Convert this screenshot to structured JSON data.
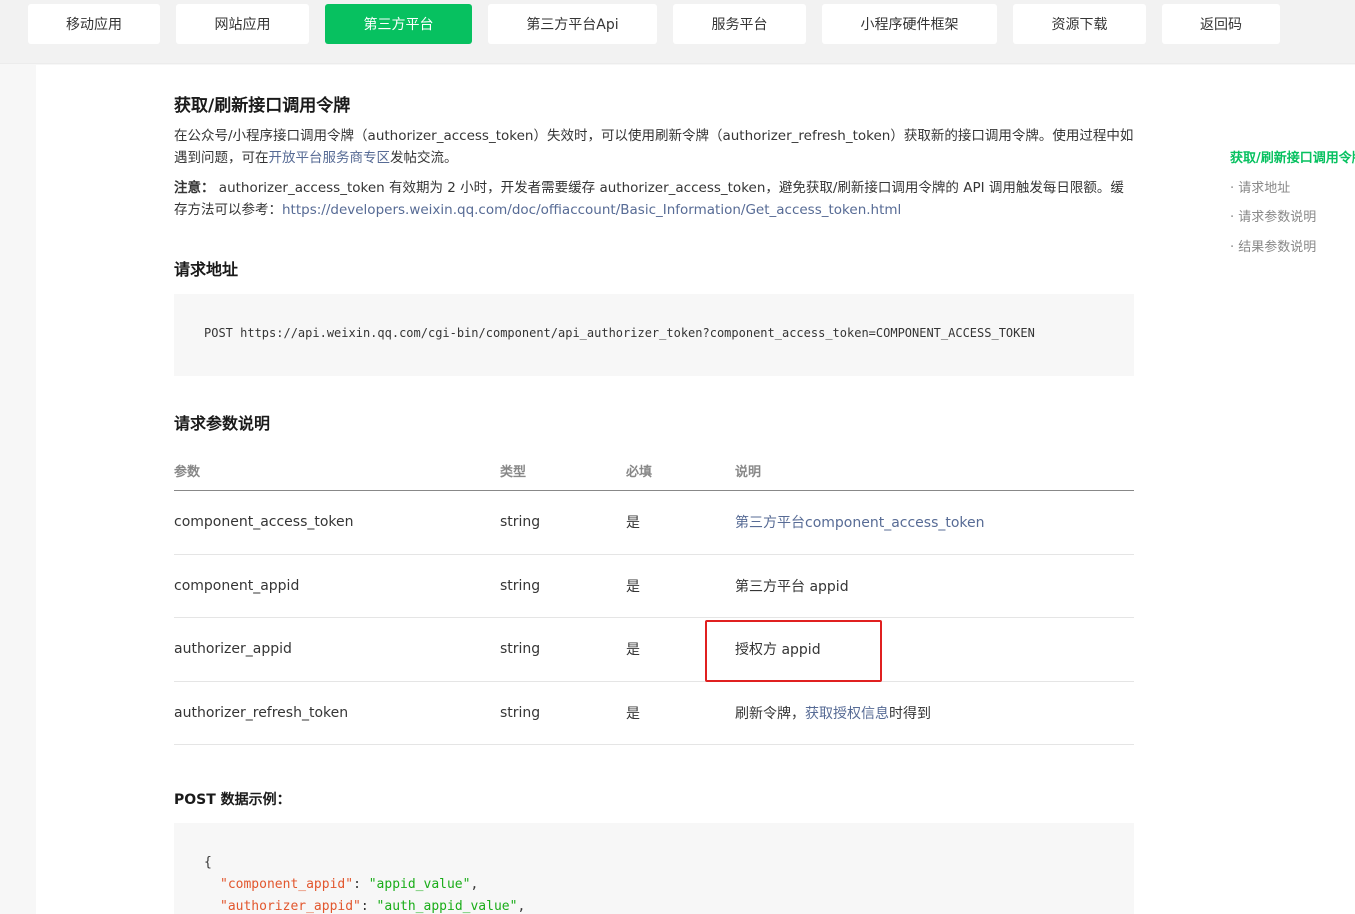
{
  "nav": {
    "tabs": [
      {
        "label": "移动应用",
        "active": false
      },
      {
        "label": "网站应用",
        "active": false
      },
      {
        "label": "第三方平台",
        "active": true
      },
      {
        "label": "第三方平台Api",
        "active": false
      },
      {
        "label": "服务平台",
        "active": false
      },
      {
        "label": "小程序硬件框架",
        "active": false
      },
      {
        "label": "资源下载",
        "active": false
      },
      {
        "label": "返回码",
        "active": false
      }
    ]
  },
  "doc": {
    "title": "获取/刷新接口调用令牌",
    "intro_1": "在公众号/小程序接口调用令牌（authorizer_access_token）失效时，可以使用刷新令牌（authorizer_refresh_token）获取新的接口调用令牌。使用过程中如遇到问题，可在",
    "intro_link": "开放平台服务商专区",
    "intro_2": "发帖交流。",
    "note_label": "注意：",
    "note_text": " authorizer_access_token 有效期为 2 小时，开发者需要缓存 authorizer_access_token，避免获取/刷新接口调用令牌的 API 调用触发每日限额。缓存方法可以参考：",
    "note_link": "https://developers.weixin.qq.com/doc/offiaccount/Basic_Information/Get_access_token.html",
    "request_url_title": "请求地址",
    "request_url": "POST https://api.weixin.qq.com/cgi-bin/component/api_authorizer_token?component_access_token=COMPONENT_ACCESS_TOKEN",
    "params_title": "请求参数说明",
    "params_headers": [
      "参数",
      "类型",
      "必填",
      "说明"
    ],
    "params_rows": [
      {
        "name": "component_access_token",
        "type": "string",
        "required": "是",
        "desc": "",
        "desc_link": "第三方平台component_access_token",
        "desc_after": ""
      },
      {
        "name": "component_appid",
        "type": "string",
        "required": "是",
        "desc": "第三方平台 appid",
        "desc_link": "",
        "desc_after": ""
      },
      {
        "name": "authorizer_appid",
        "type": "string",
        "required": "是",
        "desc": "授权方 appid",
        "desc_link": "",
        "desc_after": ""
      },
      {
        "name": "authorizer_refresh_token",
        "type": "string",
        "required": "是",
        "desc": "刷新令牌，",
        "desc_link": "获取授权信息",
        "desc_after": "时得到"
      }
    ],
    "post_example_title": "POST 数据示例：",
    "post_example": {
      "open": "{",
      "lines": [
        {
          "key": "\"component_appid\"",
          "sep": ": ",
          "value": "\"appid_value\"",
          "end": ","
        },
        {
          "key": "\"authorizer_appid\"",
          "sep": ": ",
          "value": "\"auth_appid_value\"",
          "end": ","
        }
      ]
    }
  },
  "toc": {
    "items": [
      {
        "label": "获取/刷新接口调用令牌",
        "active": true
      },
      {
        "label": "· 请求地址",
        "active": false
      },
      {
        "label": "· 请求参数说明",
        "active": false
      },
      {
        "label": "· 结果参数说明",
        "active": false
      }
    ]
  }
}
